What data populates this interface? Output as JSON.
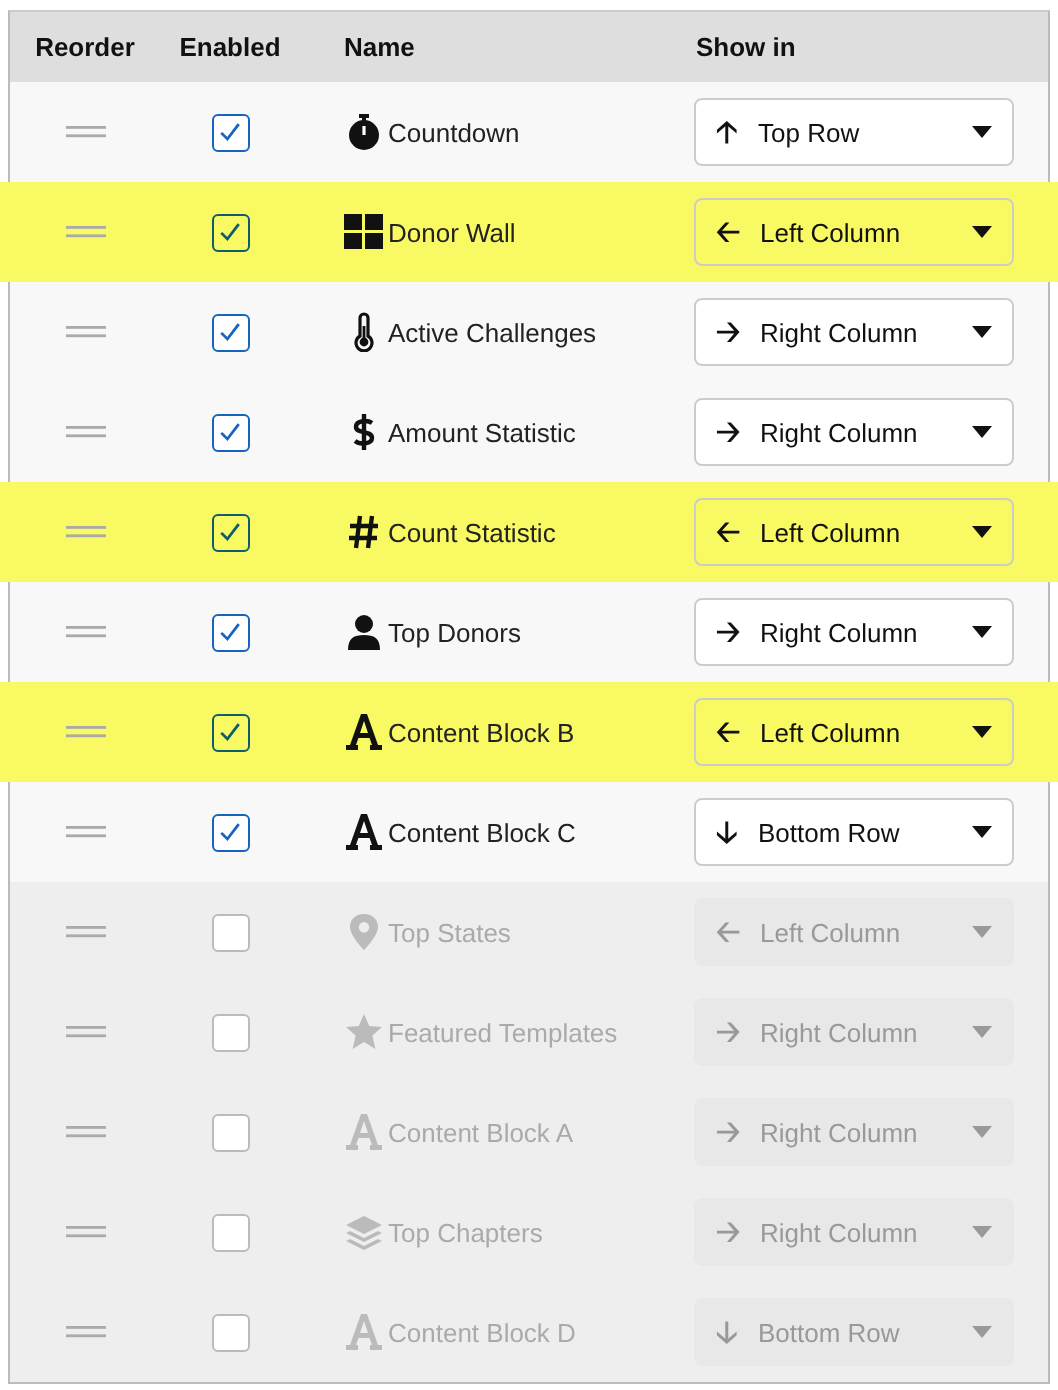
{
  "columns": [
    "Reorder",
    "Enabled",
    "Name",
    "Show in"
  ],
  "rows": [
    {
      "kind": "stopwatch",
      "name": "Countdown",
      "enabled": true,
      "highlighted": false,
      "arrow": "🡡",
      "show_in": "Top Row"
    },
    {
      "kind": "grid",
      "name": "Donor Wall",
      "enabled": true,
      "highlighted": true,
      "arrow": "🡠",
      "show_in": "Left Column"
    },
    {
      "kind": "thermometer",
      "name": "Active Challenges",
      "enabled": true,
      "highlighted": false,
      "arrow": "🡢",
      "show_in": "Right Column"
    },
    {
      "kind": "dollar",
      "name": "Amount Statistic",
      "enabled": true,
      "highlighted": false,
      "arrow": "🡢",
      "show_in": "Right Column"
    },
    {
      "kind": "hash",
      "name": "Count Statistic",
      "enabled": true,
      "highlighted": true,
      "arrow": "🡠",
      "show_in": "Left Column"
    },
    {
      "kind": "person",
      "name": "Top Donors",
      "enabled": true,
      "highlighted": false,
      "arrow": "🡢",
      "show_in": "Right Column"
    },
    {
      "kind": "letter",
      "name": "Content Block B",
      "enabled": true,
      "highlighted": true,
      "arrow": "🡠",
      "show_in": "Left Column"
    },
    {
      "kind": "letter",
      "name": "Content Block C",
      "enabled": true,
      "highlighted": false,
      "arrow": "🡣",
      "show_in": "Bottom Row"
    },
    {
      "kind": "marker",
      "name": "Top States",
      "enabled": false,
      "highlighted": false,
      "arrow": "🡠",
      "show_in": "Left Column"
    },
    {
      "kind": "star",
      "name": "Featured Templates",
      "enabled": false,
      "highlighted": false,
      "arrow": "🡢",
      "show_in": "Right Column"
    },
    {
      "kind": "letter",
      "name": "Content Block A",
      "enabled": false,
      "highlighted": false,
      "arrow": "🡢",
      "show_in": "Right Column"
    },
    {
      "kind": "layers",
      "name": "Top Chapters",
      "enabled": false,
      "highlighted": false,
      "arrow": "🡢",
      "show_in": "Right Column"
    },
    {
      "kind": "letter",
      "name": "Content Block D",
      "enabled": false,
      "highlighted": false,
      "arrow": "🡣",
      "show_in": "Bottom Row"
    }
  ]
}
